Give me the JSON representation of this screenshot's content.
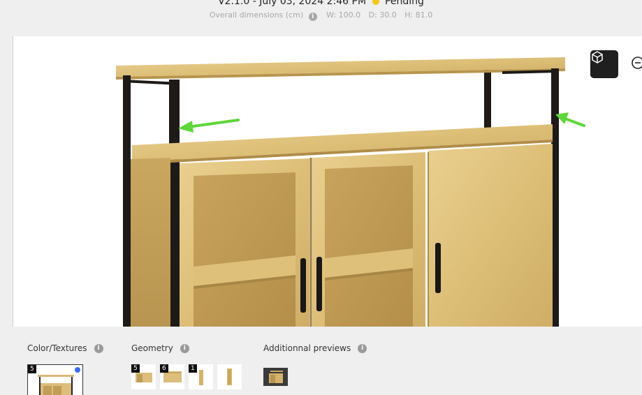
{
  "header": {
    "version_text": "V2.1.0 - July 03, 2024 2:46 PM",
    "status_label": "Pending",
    "status_color": "#f5c518",
    "dimensions_label": "Overall dimensions (cm)",
    "width": "W: 100.0",
    "depth": "D: 30.0",
    "height": "H: 81.0"
  },
  "viewer": {
    "view_3d_icon": "cube-icon",
    "zoom_icon": "zoom-out-icon",
    "annotation_color": "#5fd63a"
  },
  "sections": {
    "color_textures": {
      "label": "Color/Textures",
      "thumbs": [
        {
          "badge": "5"
        }
      ]
    },
    "geometry": {
      "label": "Geometry",
      "thumbs": [
        {
          "badge": "5"
        },
        {
          "badge": "6"
        },
        {
          "badge": "1"
        },
        {
          "badge": ""
        }
      ]
    },
    "additional": {
      "label": "Additionnal previews",
      "thumbs": [
        {
          "badge": ""
        }
      ]
    }
  }
}
